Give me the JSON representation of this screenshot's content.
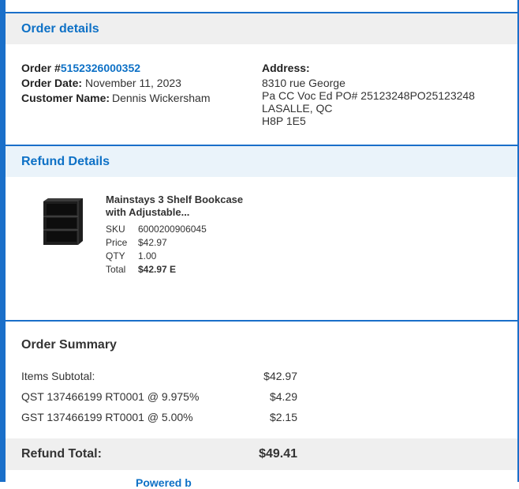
{
  "order_details": {
    "section_title": "Order details",
    "order_label": "Order #",
    "order_number": "5152326000352",
    "order_date_label": "Order Date:",
    "order_date": "November 11, 2023",
    "customer_label": "Customer Name:",
    "customer_name": "Dennis Wickersham",
    "address_label": "Address:",
    "address_lines": [
      "8310 rue George",
      "Pa CC Voc Ed PO# 25123248PO25123248",
      "LASALLE, QC",
      "H8P 1E5"
    ]
  },
  "refund_details": {
    "section_title": "Refund Details",
    "item": {
      "name": "Mainstays 3 Shelf Bookcase with Adjustable...",
      "sku_label": "SKU",
      "sku": "6000200906045",
      "price_label": "Price",
      "price": "$42.97",
      "qty_label": "QTY",
      "qty": "1.00",
      "total_label": "Total",
      "total": "$42.97 E",
      "image_icon": "bookcase-thumbnail"
    }
  },
  "order_summary": {
    "title": "Order Summary",
    "rows": [
      {
        "label": "Items Subtotal:",
        "value": "$42.97"
      },
      {
        "label": "QST 137466199 RT0001 @ 9.975%",
        "value": "$4.29"
      },
      {
        "label": "GST 137466199 RT0001 @ 5.00%",
        "value": "$2.15"
      }
    ],
    "refund_total_label": "Refund Total:",
    "refund_total": "$49.41"
  },
  "footer": {
    "partial_link": "Powered b"
  },
  "colors": {
    "accent": "#0e71c6",
    "border": "#1a6fc9",
    "header_grey": "#efefef",
    "header_blue": "#eaf3fa"
  }
}
